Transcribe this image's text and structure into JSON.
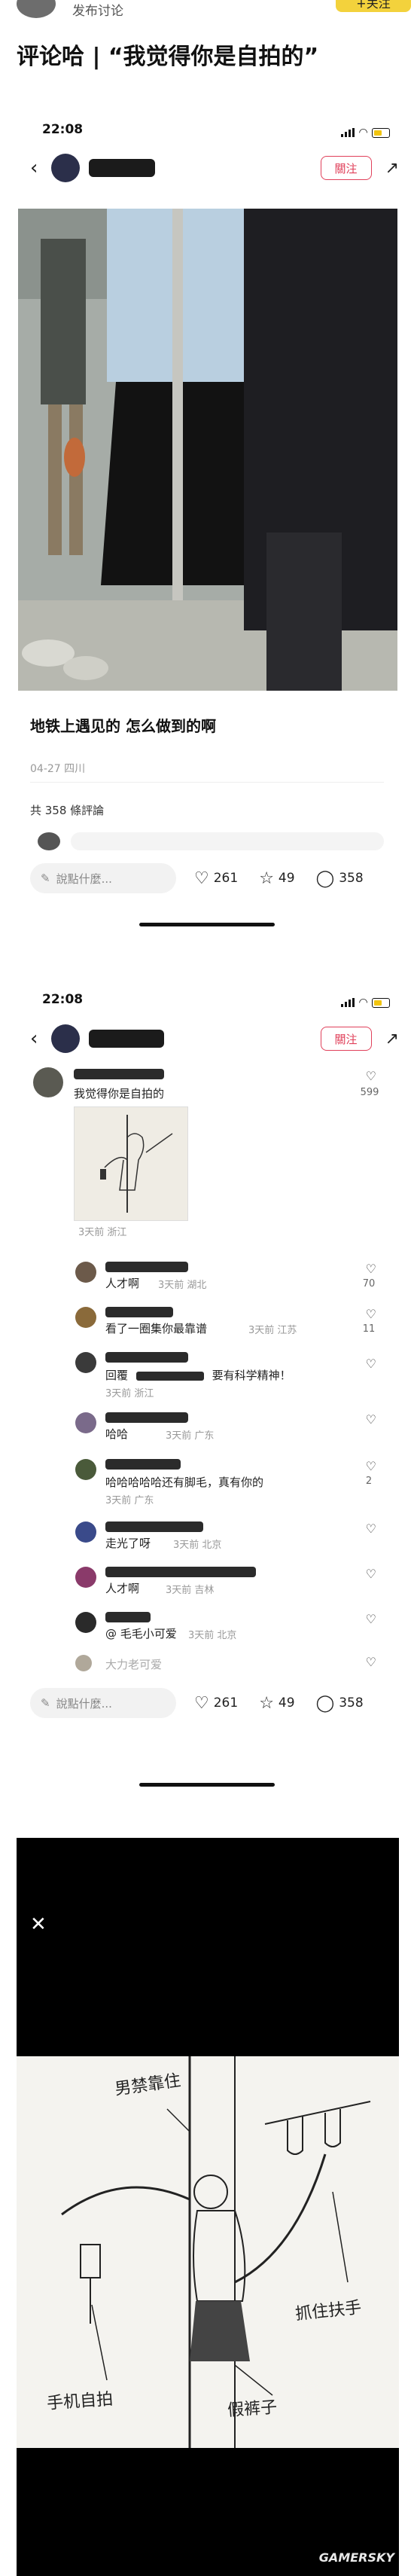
{
  "header": {
    "publish_label": "发布讨论",
    "follow_label": "+关注",
    "title": "评论哈 | “我觉得你是自拍的”"
  },
  "screen1": {
    "time": "22:08",
    "follow_label": "關注",
    "caption": "地铁上遇见的 怎么做到的啊",
    "date": "04-27 四川",
    "comment_count": "共 358 條評論",
    "comment_placeholder": "說點什麼...",
    "likes": "261",
    "stars": "49",
    "comments": "358"
  },
  "screen2": {
    "time": "22:08",
    "follow_label": "關注",
    "top_comment": {
      "text": "我觉得你是自拍的",
      "likes": "599",
      "time": "3天前 浙江"
    },
    "comments": [
      {
        "text": "人才啊",
        "time": "3天前 湖北",
        "likes": "70"
      },
      {
        "text": "看了一圈集你最靠谱",
        "time": "3天前 江苏",
        "likes": "11"
      },
      {
        "text": "回覆",
        "text2": "要有科学精神！",
        "time": "3天前 浙江",
        "likes": ""
      },
      {
        "text": "哈哈",
        "time": "3天前 广东",
        "likes": ""
      },
      {
        "text": "哈哈哈哈哈还有脚毛，真有你的",
        "time": "3天前 广东",
        "likes": "2"
      },
      {
        "text": "走光了呀",
        "time": "3天前 北京",
        "likes": ""
      },
      {
        "text": "人才啊",
        "time": "3天前 吉林",
        "likes": ""
      },
      {
        "text": "@ 毛毛小可爱",
        "time": "3天前 北京",
        "likes": ""
      },
      {
        "text": "大力老可爱",
        "time": "",
        "likes": ""
      }
    ],
    "comment_placeholder": "說點什麼...",
    "likes": "261",
    "stars": "49",
    "comments_total": "358"
  },
  "sketch": {
    "label_top": "男禁靠住",
    "label_right": "抓住扶手",
    "label_left": "手机自拍",
    "label_bottom": "假裤子"
  },
  "watermark": "GAMERSKY",
  "colors": {
    "accent": "#e0405a",
    "yellow": "#f3d23c"
  }
}
